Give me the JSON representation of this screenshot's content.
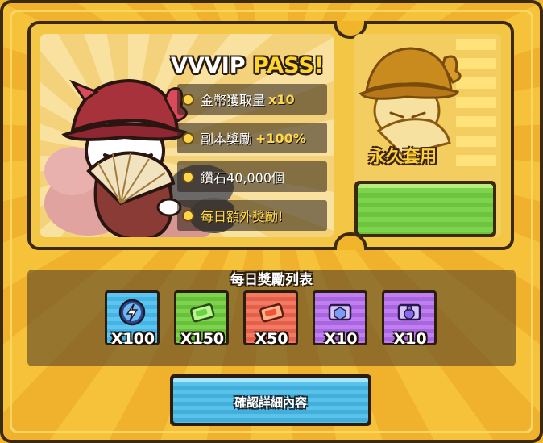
{
  "pass": {
    "title_main": "VVVIP ",
    "title_highlight": "PASS!",
    "benefits": [
      {
        "label": "金幣獲取量",
        "value": "x10"
      },
      {
        "label": "副本獎勵",
        "value": "+100%"
      },
      {
        "label": "鑽石 ",
        "value": "40,000個"
      },
      {
        "label": "每日額外獎勵!",
        "value": ""
      }
    ],
    "duration_label": "永久套用",
    "buy_button_label": ""
  },
  "daily": {
    "title": "每日獎勵列表",
    "rewards": [
      {
        "icon": "energy-icon",
        "quantity": "X100",
        "color": "#4fb8e6"
      },
      {
        "icon": "green-ticket-icon",
        "quantity": "X150",
        "color": "#74ca44"
      },
      {
        "icon": "red-ticket-icon",
        "quantity": "X50",
        "color": "#ec6c55"
      },
      {
        "icon": "blue-cube-icon",
        "quantity": "X10",
        "color": "#b473e8"
      },
      {
        "icon": "purple-potion-icon",
        "quantity": "X10",
        "color": "#b473e8"
      }
    ]
  },
  "details_button": {
    "label": "確認詳細內容"
  }
}
